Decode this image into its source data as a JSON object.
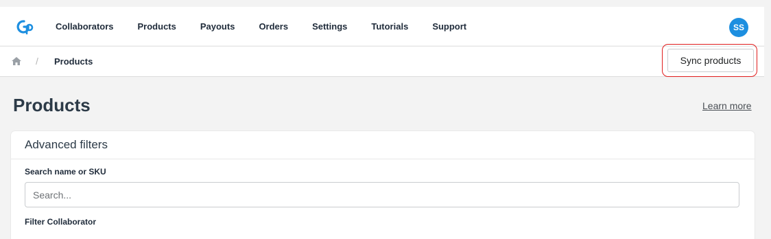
{
  "nav": {
    "logo_icon": "gp-logo-icon",
    "items": [
      "Collaborators",
      "Products",
      "Payouts",
      "Orders",
      "Settings",
      "Tutorials",
      "Support"
    ],
    "avatar_initials": "SS",
    "avatar_color": "#1d8fe0"
  },
  "breadcrumb": {
    "home_icon": "home-icon",
    "separator": "/",
    "current": "Products"
  },
  "actions": {
    "sync_label": "Sync products",
    "highlight_color": "#e01b1b"
  },
  "page": {
    "title": "Products",
    "learn_more": "Learn more"
  },
  "filters": {
    "title": "Advanced filters",
    "search_label": "Search name or SKU",
    "search_placeholder": "Search...",
    "search_value": "",
    "collaborator_label": "Filter Collaborator"
  }
}
